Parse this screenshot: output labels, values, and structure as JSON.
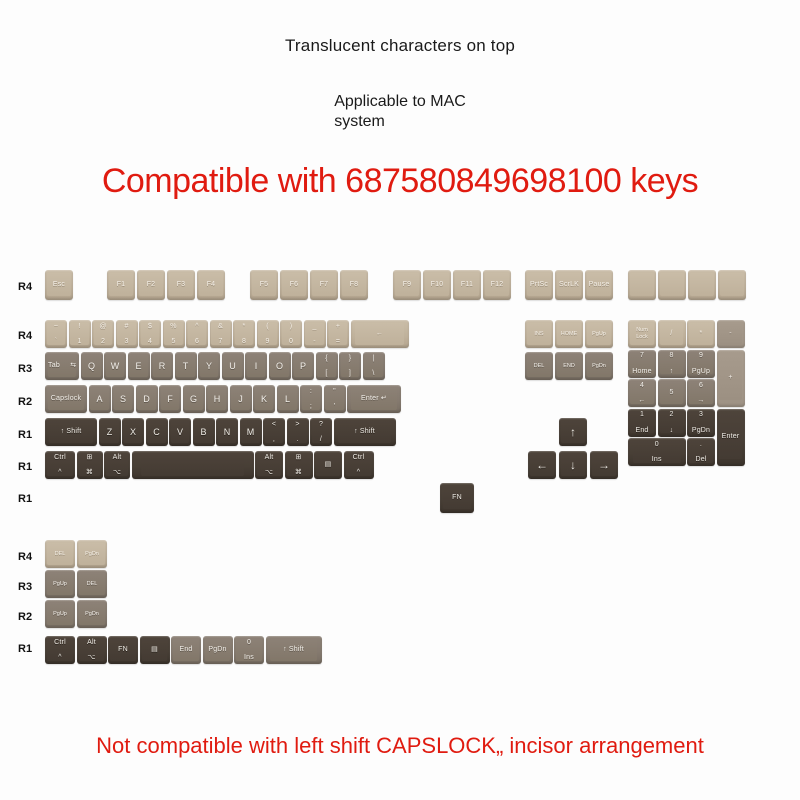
{
  "headings": {
    "translucent": "Translucent characters on top",
    "mac_line1": "Applicable to MAC",
    "mac_line2": "system",
    "compatible": "Compatible with 687580849698100 keys",
    "warning": "Not compatible with left shift CAPSLOCK„ incisor arrangement"
  },
  "colors": {
    "red_text": "#e01b10",
    "tan_key": "#c0b29c",
    "gray_key": "#857a6f",
    "dark_key": "#483f36",
    "light_gray_key": "#9e9284",
    "background": "#fdfdfd"
  },
  "row_labels": {
    "fn_row": "R4",
    "num_row": "R4",
    "qwerty_row": "R3",
    "home_row": "R2",
    "shift_row": "R1",
    "bottom_row": "R1",
    "fn_key_row": "R1",
    "extra_r4": "R4",
    "extra_r3": "R3",
    "extra_r2": "R2",
    "extra_r1": "R1"
  },
  "keyboard": {
    "fn_row": [
      {
        "name": "esc",
        "center": "Esc",
        "color": "tan"
      },
      {
        "name": "f1",
        "center": "F1",
        "color": "tan"
      },
      {
        "name": "f2",
        "center": "F2",
        "color": "tan"
      },
      {
        "name": "f3",
        "center": "F3",
        "color": "tan"
      },
      {
        "name": "f4",
        "center": "F4",
        "color": "tan"
      },
      {
        "name": "f5",
        "center": "F5",
        "color": "tan"
      },
      {
        "name": "f6",
        "center": "F6",
        "color": "tan"
      },
      {
        "name": "f7",
        "center": "F7",
        "color": "tan"
      },
      {
        "name": "f8",
        "center": "F8",
        "color": "tan"
      },
      {
        "name": "f9",
        "center": "F9",
        "color": "tan"
      },
      {
        "name": "f10",
        "center": "F10",
        "color": "tan"
      },
      {
        "name": "f11",
        "center": "F11",
        "color": "tan"
      },
      {
        "name": "f12",
        "center": "F12",
        "color": "tan"
      },
      {
        "name": "prtsc",
        "center": "PrtSc",
        "color": "tan"
      },
      {
        "name": "scrlk",
        "center": "ScrLK",
        "color": "tan"
      },
      {
        "name": "pause",
        "center": "Pause",
        "color": "tan"
      },
      {
        "name": "blank-1",
        "center": "",
        "color": "tan"
      },
      {
        "name": "blank-2",
        "center": "",
        "color": "tan"
      },
      {
        "name": "blank-3",
        "center": "",
        "color": "tan"
      },
      {
        "name": "blank-4",
        "center": "",
        "color": "tan"
      }
    ],
    "num_row": [
      {
        "name": "tilde",
        "top": "~",
        "bottom": "`",
        "color": "tan"
      },
      {
        "name": "one",
        "top": "!",
        "bottom": "1",
        "color": "tan"
      },
      {
        "name": "two",
        "top": "@",
        "bottom": "2",
        "color": "tan"
      },
      {
        "name": "three",
        "top": "#",
        "bottom": "3",
        "color": "tan"
      },
      {
        "name": "four",
        "top": "$",
        "bottom": "4",
        "color": "tan"
      },
      {
        "name": "five",
        "top": "%",
        "bottom": "5",
        "color": "tan"
      },
      {
        "name": "six",
        "top": "^",
        "bottom": "6",
        "color": "tan"
      },
      {
        "name": "seven",
        "top": "&",
        "bottom": "7",
        "color": "tan"
      },
      {
        "name": "eight",
        "top": "*",
        "bottom": "8",
        "color": "tan"
      },
      {
        "name": "nine",
        "top": "(",
        "bottom": "9",
        "color": "tan"
      },
      {
        "name": "zero",
        "top": ")",
        "bottom": "0",
        "color": "tan"
      },
      {
        "name": "minus",
        "top": "_",
        "bottom": "-",
        "color": "tan"
      },
      {
        "name": "equal",
        "top": "+",
        "bottom": "=",
        "color": "tan"
      },
      {
        "name": "backspace",
        "center": "←",
        "color": "tan"
      }
    ],
    "qwerty_row": [
      {
        "name": "tab",
        "left": "Tab",
        "color": "gray"
      },
      {
        "name": "q",
        "center": "Q",
        "color": "gray"
      },
      {
        "name": "w",
        "center": "W",
        "color": "gray"
      },
      {
        "name": "e",
        "center": "E",
        "color": "gray"
      },
      {
        "name": "r",
        "center": "R",
        "color": "gray"
      },
      {
        "name": "t",
        "center": "T",
        "color": "gray"
      },
      {
        "name": "y",
        "center": "Y",
        "color": "gray"
      },
      {
        "name": "u",
        "center": "U",
        "color": "gray"
      },
      {
        "name": "i",
        "center": "I",
        "color": "gray"
      },
      {
        "name": "o",
        "center": "O",
        "color": "gray"
      },
      {
        "name": "p",
        "center": "P",
        "color": "gray"
      },
      {
        "name": "bracket-left",
        "top": "{",
        "bottom": "[",
        "color": "gray"
      },
      {
        "name": "bracket-right",
        "top": "}",
        "bottom": "]",
        "color": "gray"
      },
      {
        "name": "backslash",
        "top": "|",
        "bottom": "\\",
        "color": "gray"
      }
    ],
    "home_row": [
      {
        "name": "capslock",
        "center": "Capslock",
        "color": "gray"
      },
      {
        "name": "a",
        "center": "A",
        "color": "gray"
      },
      {
        "name": "s",
        "center": "S",
        "color": "gray"
      },
      {
        "name": "d",
        "center": "D",
        "color": "gray"
      },
      {
        "name": "f",
        "center": "F",
        "color": "gray"
      },
      {
        "name": "g",
        "center": "G",
        "color": "gray"
      },
      {
        "name": "h",
        "center": "H",
        "color": "gray"
      },
      {
        "name": "j",
        "center": "J",
        "color": "gray"
      },
      {
        "name": "k",
        "center": "K",
        "color": "gray"
      },
      {
        "name": "l",
        "center": "L",
        "color": "gray"
      },
      {
        "name": "semicolon",
        "top": ":",
        "bottom": ";",
        "color": "gray"
      },
      {
        "name": "quote",
        "top": "\"",
        "bottom": "'",
        "color": "gray"
      },
      {
        "name": "enter",
        "center": "Enter ↵",
        "color": "gray"
      }
    ],
    "shift_row": [
      {
        "name": "shift-left",
        "center": "↑ Shift",
        "color": "dark"
      },
      {
        "name": "z",
        "center": "Z",
        "color": "dark"
      },
      {
        "name": "x",
        "center": "X",
        "color": "dark"
      },
      {
        "name": "c",
        "center": "C",
        "color": "dark"
      },
      {
        "name": "v",
        "center": "V",
        "color": "dark"
      },
      {
        "name": "b",
        "center": "B",
        "color": "dark"
      },
      {
        "name": "n",
        "center": "N",
        "color": "dark"
      },
      {
        "name": "m",
        "center": "M",
        "color": "dark"
      },
      {
        "name": "comma",
        "top": "<",
        "bottom": ",",
        "color": "dark"
      },
      {
        "name": "period",
        "top": ">",
        "bottom": ".",
        "color": "dark"
      },
      {
        "name": "slash",
        "top": "?",
        "bottom": "/",
        "color": "dark"
      },
      {
        "name": "shift-right",
        "center": "↑ Shift",
        "color": "dark"
      }
    ],
    "bottom_row": [
      {
        "name": "ctrl-left",
        "top": "Ctrl",
        "bottom": "^",
        "color": "dark"
      },
      {
        "name": "win-left",
        "top": "⊞",
        "bottom": "⌘",
        "color": "dark"
      },
      {
        "name": "alt-left",
        "top": "Alt",
        "bottom": "⌥",
        "color": "dark"
      },
      {
        "name": "space",
        "center": "",
        "color": "dark"
      },
      {
        "name": "alt-right",
        "top": "Alt",
        "bottom": "⌥",
        "color": "dark"
      },
      {
        "name": "win-right",
        "top": "⊞",
        "bottom": "⌘",
        "color": "dark"
      },
      {
        "name": "menu",
        "center": "▤",
        "color": "dark"
      },
      {
        "name": "ctrl-right",
        "top": "Ctrl",
        "bottom": "^",
        "color": "dark"
      }
    ],
    "fn_key": {
      "name": "fn",
      "center": "FN",
      "color": "dark"
    },
    "nav_cluster": [
      {
        "name": "ins",
        "center": "INS",
        "color": "tan"
      },
      {
        "name": "home",
        "center": "HOME",
        "color": "tan"
      },
      {
        "name": "pgup",
        "center": "PgUp",
        "color": "tan"
      },
      {
        "name": "del",
        "center": "DEL",
        "color": "gray"
      },
      {
        "name": "end",
        "center": "END",
        "color": "gray"
      },
      {
        "name": "pgdn",
        "center": "PgDn",
        "color": "gray"
      }
    ],
    "arrow_cluster": [
      {
        "name": "arrow-up",
        "center": "↑",
        "color": "dark"
      },
      {
        "name": "arrow-left",
        "center": "←",
        "color": "dark"
      },
      {
        "name": "arrow-down",
        "center": "↓",
        "color": "dark"
      },
      {
        "name": "arrow-right",
        "center": "→",
        "color": "dark"
      }
    ],
    "numpad": [
      {
        "name": "numlock",
        "line1": "Num",
        "line2": "Lock",
        "color": "tan"
      },
      {
        "name": "numpad-divide",
        "center": "/",
        "color": "tan"
      },
      {
        "name": "numpad-multiply",
        "center": "*",
        "color": "tan"
      },
      {
        "name": "numpad-minus",
        "center": "-",
        "color": "lgray"
      },
      {
        "name": "numpad-7",
        "top": "7",
        "bottom": "Home",
        "color": "gray"
      },
      {
        "name": "numpad-8",
        "top": "8",
        "bottom": "↑",
        "color": "gray"
      },
      {
        "name": "numpad-9",
        "top": "9",
        "bottom": "PgUp",
        "color": "gray"
      },
      {
        "name": "numpad-plus",
        "center": "+",
        "color": "lgray"
      },
      {
        "name": "numpad-4",
        "top": "4",
        "bottom": "←",
        "color": "gray"
      },
      {
        "name": "numpad-5",
        "center": "5",
        "color": "gray"
      },
      {
        "name": "numpad-6",
        "top": "6",
        "bottom": "→",
        "color": "gray"
      },
      {
        "name": "numpad-1",
        "top": "1",
        "bottom": "End",
        "color": "dark"
      },
      {
        "name": "numpad-2",
        "top": "2",
        "bottom": "↓",
        "color": "dark"
      },
      {
        "name": "numpad-3",
        "top": "3",
        "bottom": "PgDn",
        "color": "dark"
      },
      {
        "name": "numpad-enter",
        "center": "Enter",
        "color": "dark"
      },
      {
        "name": "numpad-0",
        "top": "0",
        "bottom": "Ins",
        "color": "dark"
      },
      {
        "name": "numpad-period",
        "top": ".",
        "bottom": "Del",
        "color": "dark"
      }
    ],
    "extra_r4": [
      {
        "name": "extra-del",
        "center": "DEL",
        "color": "tan"
      },
      {
        "name": "extra-pgdn",
        "center": "PgDn",
        "color": "tan"
      }
    ],
    "extra_r3": [
      {
        "name": "extra-pgup-r3",
        "center": "PgUp",
        "color": "gray"
      },
      {
        "name": "extra-del-r3",
        "center": "DEL",
        "color": "gray"
      }
    ],
    "extra_r2": [
      {
        "name": "extra-pgup-r2",
        "center": "PgUp",
        "color": "gray"
      },
      {
        "name": "extra-pgdn-r2",
        "center": "PgDn",
        "color": "gray"
      }
    ],
    "extra_r1": [
      {
        "name": "extra-ctrl",
        "top": "Ctrl",
        "bottom": "^",
        "color": "dark"
      },
      {
        "name": "extra-alt",
        "top": "Alt",
        "bottom": "⌥",
        "color": "dark"
      },
      {
        "name": "extra-fn",
        "center": "FN",
        "color": "dark"
      },
      {
        "name": "extra-menu",
        "center": "▤",
        "color": "dark"
      },
      {
        "name": "extra-end",
        "center": "End",
        "color": "gray"
      },
      {
        "name": "extra-pgdn-r1",
        "center": "PgDn",
        "color": "gray"
      },
      {
        "name": "extra-zero",
        "top": "0",
        "bottom": "Ins",
        "color": "gray"
      },
      {
        "name": "extra-shift",
        "center": "↑ Shift",
        "color": "gray"
      }
    ]
  }
}
